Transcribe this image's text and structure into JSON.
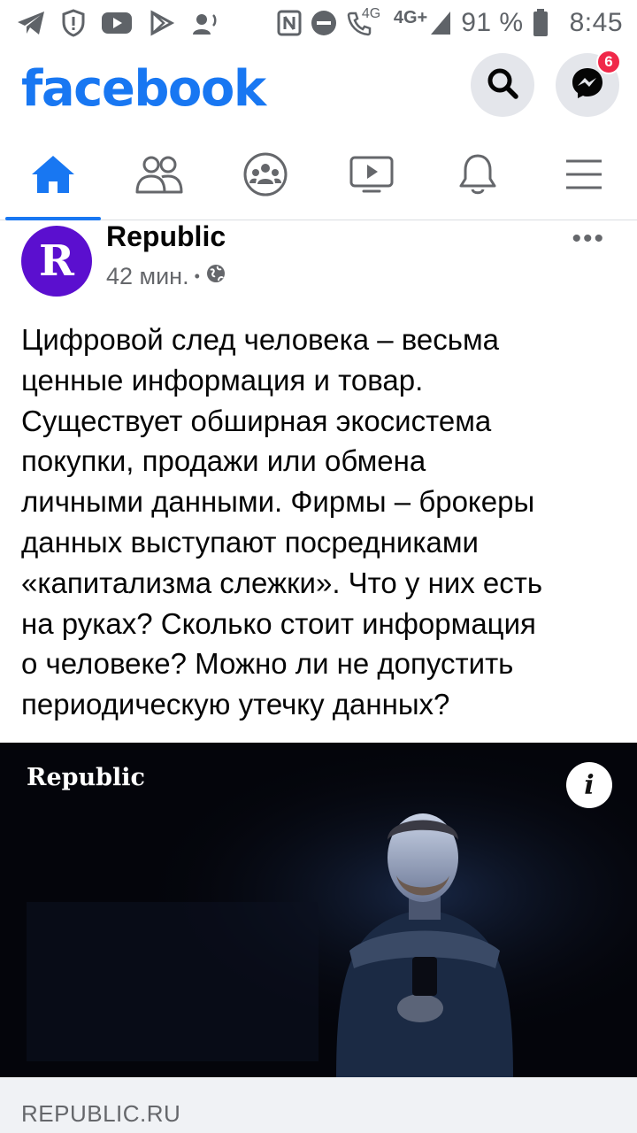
{
  "status_bar": {
    "left_icons": [
      "telegram-icon",
      "shield-alert-icon",
      "youtube-icon",
      "play-store-icon",
      "cast-icon"
    ],
    "right_icons": [
      "nfc-icon",
      "do-not-disturb-icon",
      "wifi-calling-icon",
      "signal-icon",
      "battery-icon"
    ],
    "call_network": "4G",
    "network": "4G+",
    "battery": "91 %",
    "time": "8:45"
  },
  "header": {
    "logo": "facebook",
    "messenger_badge": "6",
    "brand_color": "#1877f2"
  },
  "tabs": [
    {
      "name": "home",
      "icon": "home-icon",
      "active": true
    },
    {
      "name": "friends",
      "icon": "friends-icon",
      "active": false
    },
    {
      "name": "groups",
      "icon": "groups-icon",
      "active": false
    },
    {
      "name": "watch",
      "icon": "video-icon",
      "active": false
    },
    {
      "name": "notifications",
      "icon": "bell-icon",
      "active": false
    },
    {
      "name": "menu",
      "icon": "hamburger-icon",
      "active": false
    }
  ],
  "post": {
    "author": "Republic",
    "avatar_letter": "R",
    "time": "42 мин.",
    "separator": "•",
    "privacy_icon": "globe-icon",
    "more": "•••",
    "text_lines": [
      "Цифровой след человека – весьма",
      "ценные информация и товар.",
      "Существует обширная экосистема",
      "покупки, продажи или обмена",
      "личными данными. Фирмы – брокеры",
      "данных выступают посредниками",
      "«капитализма слежки». Что у них есть",
      "на руках? Сколько стоит информация",
      "о человеке? Можно ли не допустить",
      "периодическую утечку данных?"
    ],
    "image": {
      "overlay_logo": "Republic",
      "info_button": "i"
    },
    "link": {
      "domain": "REPUBLIC.RU"
    }
  }
}
